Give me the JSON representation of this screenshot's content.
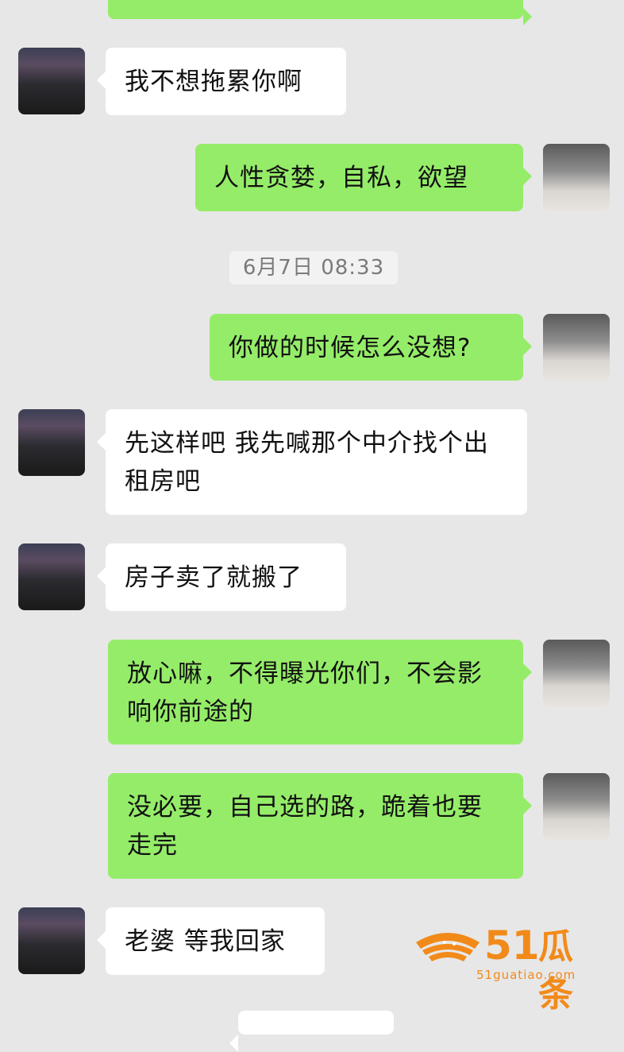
{
  "messages": [
    {
      "text": "我不想拖累你啊"
    },
    {
      "text": "人性贪婪，自私，欲望"
    },
    {
      "text": "你做的时候怎么没想?"
    },
    {
      "text": "先这样吧 我先喊那个中介找个出租房吧"
    },
    {
      "text": "房子卖了就搬了"
    },
    {
      "text": "放心嘛，不得曝光你们，不会影响你前途的"
    },
    {
      "text": "没必要，自己选的路，跪着也要走完"
    },
    {
      "text": "老婆 等我回家"
    }
  ],
  "timestamp": "6月7日 08:33",
  "watermark": {
    "brand_number": "51",
    "brand_text": "瓜条",
    "url": "51guatiao.com"
  },
  "colors": {
    "background": "#e7e7e7",
    "incoming_bubble": "#ffffff",
    "outgoing_bubble": "#95ec69",
    "watermark": "#f28a1a"
  }
}
